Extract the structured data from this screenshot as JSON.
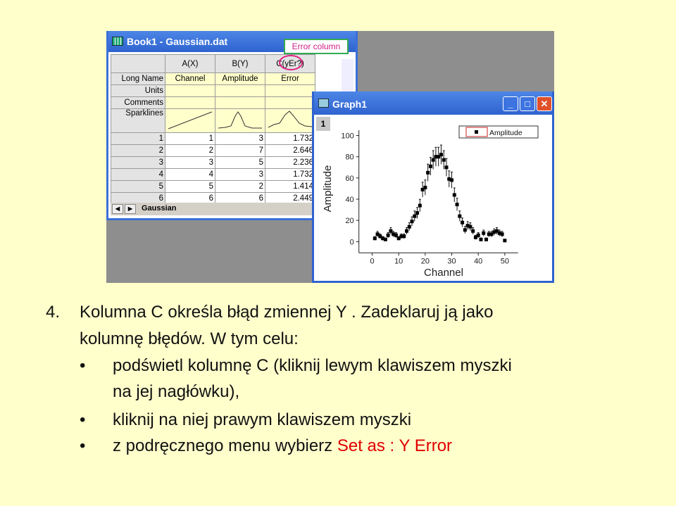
{
  "workbook": {
    "title": "Book1 - Gaussian.dat",
    "columns": [
      "A(X)",
      "B(Y)",
      "C(yEr?)"
    ],
    "row_labels": [
      "Long Name",
      "Units",
      "Comments",
      "Sparklines"
    ],
    "long_names": [
      "Channel",
      "Amplitude",
      "Error"
    ],
    "rows": [
      [
        "1",
        "1",
        "3",
        "1.732"
      ],
      [
        "2",
        "2",
        "7",
        "2.646"
      ],
      [
        "3",
        "3",
        "5",
        "2.236"
      ],
      [
        "4",
        "4",
        "3",
        "1.732"
      ],
      [
        "5",
        "5",
        "2",
        "1.414"
      ],
      [
        "6",
        "6",
        "6",
        "2.449"
      ]
    ],
    "sheet_tab": "Gaussian",
    "callout": "Error column"
  },
  "graph": {
    "title": "Graph1",
    "layer": "1",
    "buttons": {
      "minimize": "_",
      "maximize": "□",
      "close": "✕"
    }
  },
  "chart_data": {
    "type": "scatter",
    "xlabel": "Channel",
    "ylabel": "Amplitude",
    "xlim": [
      -5,
      55
    ],
    "ylim": [
      -10,
      100
    ],
    "xticks": [
      0,
      10,
      20,
      30,
      40,
      50
    ],
    "yticks": [
      0,
      20,
      40,
      60,
      80,
      100
    ],
    "legend": {
      "position": "top-right",
      "entries": [
        "Amplitude"
      ]
    },
    "grid": false,
    "series": [
      {
        "name": "Amplitude",
        "error": "sqrt(y)",
        "x": [
          1,
          2,
          3,
          4,
          5,
          6,
          7,
          8,
          9,
          10,
          11,
          12,
          13,
          14,
          15,
          16,
          17,
          18,
          19,
          20,
          21,
          22,
          23,
          24,
          25,
          26,
          27,
          28,
          29,
          30,
          31,
          32,
          33,
          34,
          35,
          36,
          37,
          38,
          39,
          40,
          41,
          42,
          43,
          44,
          45,
          46,
          47,
          48,
          49,
          50
        ],
        "y": [
          3,
          7,
          5,
          3,
          2,
          6,
          10,
          7,
          6,
          3,
          5,
          5,
          10,
          14,
          19,
          24,
          27,
          34,
          49,
          51,
          65,
          71,
          77,
          80,
          80,
          82,
          77,
          70,
          59,
          58,
          44,
          35,
          24,
          18,
          11,
          15,
          14,
          10,
          4,
          6,
          2,
          8,
          2,
          7,
          7,
          9,
          10,
          8,
          7,
          1
        ]
      }
    ]
  },
  "slide": {
    "line1_num": "4.",
    "line1": "Kolumna  C określa błąd zmiennej Y . Zadeklaruj ją jako",
    "line2": "kolumnę błędów. W tym celu:",
    "bullet": "•",
    "b1a": "podświetl kolumnę C  (kliknij lewym klawiszem myszki",
    "b1b": "na  jej nagłówku),",
    "b2": "kliknij na niej prawym klawiszem myszki",
    "b3": "z podręcznego menu wybierz ",
    "b3_red": "Set as : Y Error"
  }
}
